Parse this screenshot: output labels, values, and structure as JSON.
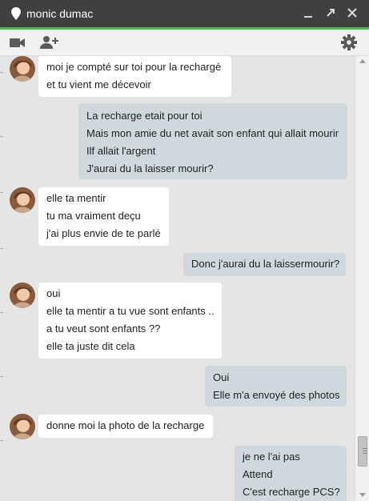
{
  "window": {
    "title": "monic dumac"
  },
  "toolbar": {
    "video_icon": "video-camera-icon",
    "add_person_icon": "add-person-icon",
    "settings_icon": "gear-icon"
  },
  "colors": {
    "titlebar": "#404040",
    "accent": "#4bbd4b",
    "incoming": "#ffffff",
    "outgoing": "#cfd8dc",
    "background": "#e5e5e5"
  },
  "messages": [
    {
      "from": "contact",
      "lines": [
        "moi je compté sur toi pour la rechargé",
        "et tu vient me décevoir"
      ]
    },
    {
      "from": "me",
      "lines": [
        "La recharge etait pour toi",
        "Mais mon amie du net avait son enfant qui allait mourir",
        "Ilf allait l'argent",
        "J'aurai du la laisser mourir?"
      ]
    },
    {
      "from": "contact",
      "lines": [
        "elle ta mentir",
        "tu ma vraiment deçu",
        "j'ai plus envie de te parlé"
      ]
    },
    {
      "from": "me",
      "lines": [
        "Donc j'aurai du la laissermourir?"
      ]
    },
    {
      "from": "contact",
      "lines": [
        "oui",
        "elle ta mentir a tu vue sont enfants ..",
        "a tu veut sont enfants ??",
        "elle ta juste dit cela"
      ]
    },
    {
      "from": "me",
      "lines": [
        "Oui",
        "Elle m'a envoyé des photos"
      ]
    },
    {
      "from": "contact",
      "lines": [
        "donne moi la photo de la recharge"
      ]
    },
    {
      "from": "me",
      "lines": [
        "je ne l'ai pas",
        "Attend",
        "C'est recharge PCS?"
      ]
    }
  ]
}
